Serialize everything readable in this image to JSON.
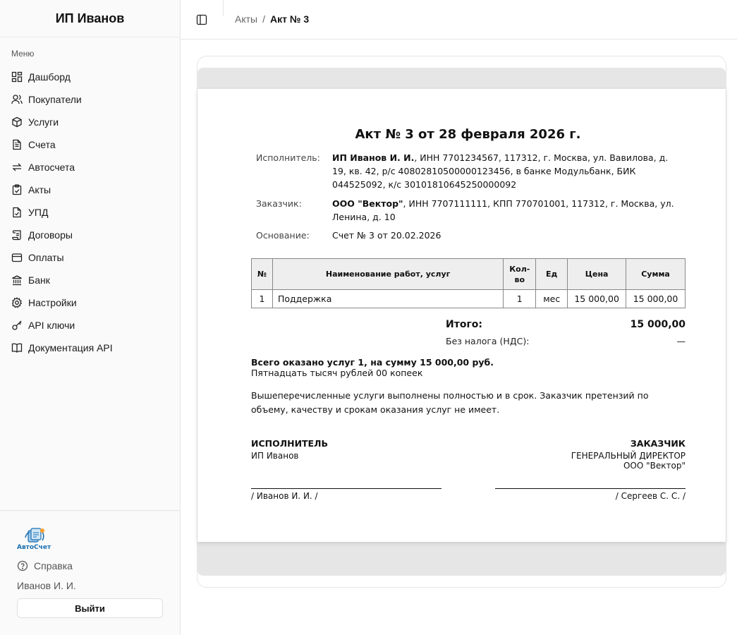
{
  "sidebar": {
    "title": "ИП Иванов",
    "menu_label": "Меню",
    "items": [
      {
        "label": "Дашборд",
        "icon": "dashboard-icon"
      },
      {
        "label": "Покупатели",
        "icon": "users-icon"
      },
      {
        "label": "Услуги",
        "icon": "box-icon"
      },
      {
        "label": "Счета",
        "icon": "document-icon"
      },
      {
        "label": "Автосчета",
        "icon": "repeat-icon"
      },
      {
        "label": "Акты",
        "icon": "clipboard-check-icon"
      },
      {
        "label": "УПД",
        "icon": "file-check-icon"
      },
      {
        "label": "Договоры",
        "icon": "scroll-icon"
      },
      {
        "label": "Оплаты",
        "icon": "wallet-icon"
      },
      {
        "label": "Банк",
        "icon": "bank-icon"
      },
      {
        "label": "Настройки",
        "icon": "gear-icon"
      },
      {
        "label": "API ключи",
        "icon": "key-icon"
      },
      {
        "label": "Документация API",
        "icon": "book-icon"
      }
    ],
    "logo_text": "АвтоСчет",
    "help_label": "Справка",
    "user_name": "Иванов И. И.",
    "logout_label": "Выйти"
  },
  "header": {
    "breadcrumb_parent": "Акты",
    "breadcrumb_sep": "/",
    "breadcrumb_current": "Акт № 3"
  },
  "document": {
    "title": "Акт № 3 от 28 февраля 2026 г.",
    "executor_label": "Исполнитель:",
    "executor_name": "ИП Иванов И. И.",
    "executor_details": ", ИНН 7701234567, 117312, г. Москва, ул. Вавилова, д. 19, кв. 42, р/с 40802810500000123456, в банке Модульбанк, БИК 044525092, к/с 30101810645250000092",
    "customer_label": "Заказчик:",
    "customer_name": "ООО \"Вектор\"",
    "customer_details": ", ИНН 7707111111, КПП 770701001, 117312, г. Москва, ул. Ленина, д. 10",
    "basis_label": "Основание:",
    "basis_value": "Счет № 3 от 20.02.2026",
    "table": {
      "headers": {
        "num": "№",
        "name": "Наименование работ, услуг",
        "qty": "Кол-во",
        "unit": "Ед",
        "price": "Цена",
        "sum": "Сумма"
      },
      "rows": [
        {
          "num": "1",
          "name": "Поддержка",
          "qty": "1",
          "unit": "мес",
          "price": "15 000,00",
          "sum": "15 000,00"
        }
      ]
    },
    "total_label": "Итого:",
    "total_value": "15 000,00",
    "tax_label": "Без налога (НДС):",
    "tax_value": "—",
    "summary_line": "Всего оказано услуг 1, на сумму 15 000,00 руб.",
    "summary_words": "Пятнадцать тысяч рублей 00 копеек",
    "statement": "Вышеперечисленные услуги выполнены полностью и в срок. Заказчик претензий по объему, качеству и срокам оказания услуг не имеет.",
    "sign_executor_head": "ИСПОЛНИТЕЛЬ",
    "sign_executor_sub": "ИП Иванов",
    "sign_executor_name": "/ Иванов И. И. /",
    "sign_customer_head": "ЗАКАЗЧИК",
    "sign_customer_position": "ГЕНЕРАЛЬНЫЙ ДИРЕКТОР",
    "sign_customer_org": "ООО \"Вектор\"",
    "sign_customer_name": "/ Сергеев С. С. /"
  }
}
